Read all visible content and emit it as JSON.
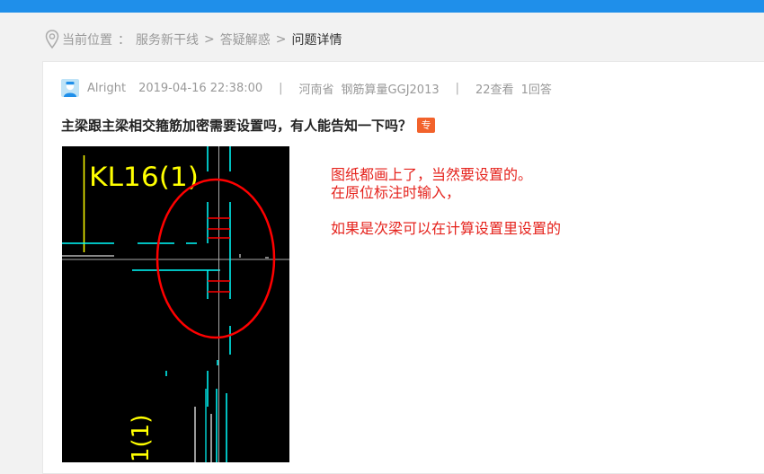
{
  "breadcrumb": {
    "location_label": "当前位置",
    "colon": "：",
    "items": [
      "服务新干线",
      "答疑解惑",
      "问题详情"
    ],
    "separator": ">"
  },
  "question": {
    "author": "Alright",
    "datetime": "2019-04-16 22:38:00",
    "separator": "|",
    "region": "河南省",
    "software": "钢筋算量GGJ2013",
    "views": "22查看",
    "answers": "1回答",
    "title": "主梁跟主梁相交箍筋加密需要设置吗，有人能告知一下吗？",
    "tag": "专"
  },
  "drawing": {
    "beam_label": "KL16(1)",
    "beam_label_bottom": "1(1)"
  },
  "answer_lines": [
    "图纸都画上了，当然要设置的。",
    "在原位标注时输入，",
    "如果是次梁可以在计算设置里设置的"
  ],
  "colors": {
    "topbar": "#1f8fea",
    "tag_bg": "#f2622b",
    "answer_text": "#e5231d",
    "drawing_bg": "#000000",
    "cad_yellow": "#ffff00",
    "cad_cyan": "#00ffff",
    "cad_red": "#ff0000"
  }
}
